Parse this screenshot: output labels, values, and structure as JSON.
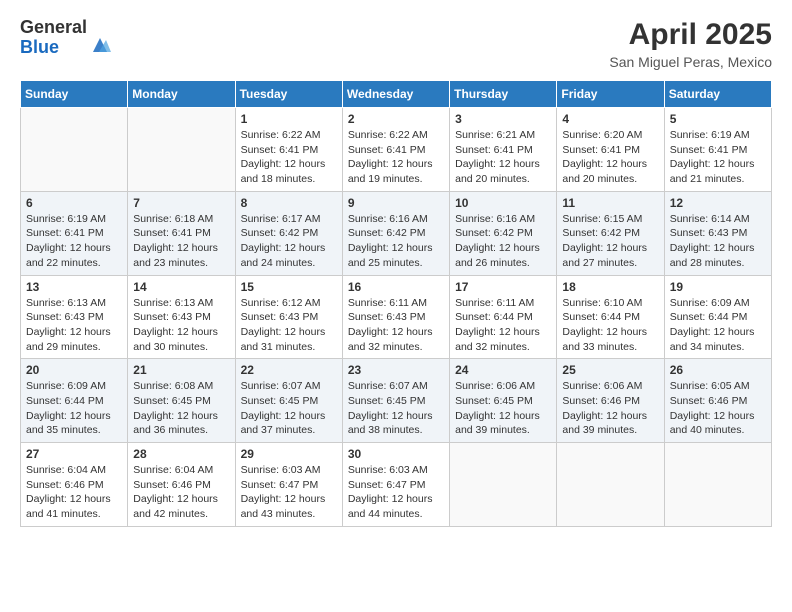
{
  "logo": {
    "general": "General",
    "blue": "Blue"
  },
  "title": "April 2025",
  "location": "San Miguel Peras, Mexico",
  "weekdays": [
    "Sunday",
    "Monday",
    "Tuesday",
    "Wednesday",
    "Thursday",
    "Friday",
    "Saturday"
  ],
  "weeks": [
    [
      {
        "day": "",
        "sunrise": "",
        "sunset": "",
        "daylight": ""
      },
      {
        "day": "",
        "sunrise": "",
        "sunset": "",
        "daylight": ""
      },
      {
        "day": "1",
        "sunrise": "Sunrise: 6:22 AM",
        "sunset": "Sunset: 6:41 PM",
        "daylight": "Daylight: 12 hours and 18 minutes."
      },
      {
        "day": "2",
        "sunrise": "Sunrise: 6:22 AM",
        "sunset": "Sunset: 6:41 PM",
        "daylight": "Daylight: 12 hours and 19 minutes."
      },
      {
        "day": "3",
        "sunrise": "Sunrise: 6:21 AM",
        "sunset": "Sunset: 6:41 PM",
        "daylight": "Daylight: 12 hours and 20 minutes."
      },
      {
        "day": "4",
        "sunrise": "Sunrise: 6:20 AM",
        "sunset": "Sunset: 6:41 PM",
        "daylight": "Daylight: 12 hours and 20 minutes."
      },
      {
        "day": "5",
        "sunrise": "Sunrise: 6:19 AM",
        "sunset": "Sunset: 6:41 PM",
        "daylight": "Daylight: 12 hours and 21 minutes."
      }
    ],
    [
      {
        "day": "6",
        "sunrise": "Sunrise: 6:19 AM",
        "sunset": "Sunset: 6:41 PM",
        "daylight": "Daylight: 12 hours and 22 minutes."
      },
      {
        "day": "7",
        "sunrise": "Sunrise: 6:18 AM",
        "sunset": "Sunset: 6:41 PM",
        "daylight": "Daylight: 12 hours and 23 minutes."
      },
      {
        "day": "8",
        "sunrise": "Sunrise: 6:17 AM",
        "sunset": "Sunset: 6:42 PM",
        "daylight": "Daylight: 12 hours and 24 minutes."
      },
      {
        "day": "9",
        "sunrise": "Sunrise: 6:16 AM",
        "sunset": "Sunset: 6:42 PM",
        "daylight": "Daylight: 12 hours and 25 minutes."
      },
      {
        "day": "10",
        "sunrise": "Sunrise: 6:16 AM",
        "sunset": "Sunset: 6:42 PM",
        "daylight": "Daylight: 12 hours and 26 minutes."
      },
      {
        "day": "11",
        "sunrise": "Sunrise: 6:15 AM",
        "sunset": "Sunset: 6:42 PM",
        "daylight": "Daylight: 12 hours and 27 minutes."
      },
      {
        "day": "12",
        "sunrise": "Sunrise: 6:14 AM",
        "sunset": "Sunset: 6:43 PM",
        "daylight": "Daylight: 12 hours and 28 minutes."
      }
    ],
    [
      {
        "day": "13",
        "sunrise": "Sunrise: 6:13 AM",
        "sunset": "Sunset: 6:43 PM",
        "daylight": "Daylight: 12 hours and 29 minutes."
      },
      {
        "day": "14",
        "sunrise": "Sunrise: 6:13 AM",
        "sunset": "Sunset: 6:43 PM",
        "daylight": "Daylight: 12 hours and 30 minutes."
      },
      {
        "day": "15",
        "sunrise": "Sunrise: 6:12 AM",
        "sunset": "Sunset: 6:43 PM",
        "daylight": "Daylight: 12 hours and 31 minutes."
      },
      {
        "day": "16",
        "sunrise": "Sunrise: 6:11 AM",
        "sunset": "Sunset: 6:43 PM",
        "daylight": "Daylight: 12 hours and 32 minutes."
      },
      {
        "day": "17",
        "sunrise": "Sunrise: 6:11 AM",
        "sunset": "Sunset: 6:44 PM",
        "daylight": "Daylight: 12 hours and 32 minutes."
      },
      {
        "day": "18",
        "sunrise": "Sunrise: 6:10 AM",
        "sunset": "Sunset: 6:44 PM",
        "daylight": "Daylight: 12 hours and 33 minutes."
      },
      {
        "day": "19",
        "sunrise": "Sunrise: 6:09 AM",
        "sunset": "Sunset: 6:44 PM",
        "daylight": "Daylight: 12 hours and 34 minutes."
      }
    ],
    [
      {
        "day": "20",
        "sunrise": "Sunrise: 6:09 AM",
        "sunset": "Sunset: 6:44 PM",
        "daylight": "Daylight: 12 hours and 35 minutes."
      },
      {
        "day": "21",
        "sunrise": "Sunrise: 6:08 AM",
        "sunset": "Sunset: 6:45 PM",
        "daylight": "Daylight: 12 hours and 36 minutes."
      },
      {
        "day": "22",
        "sunrise": "Sunrise: 6:07 AM",
        "sunset": "Sunset: 6:45 PM",
        "daylight": "Daylight: 12 hours and 37 minutes."
      },
      {
        "day": "23",
        "sunrise": "Sunrise: 6:07 AM",
        "sunset": "Sunset: 6:45 PM",
        "daylight": "Daylight: 12 hours and 38 minutes."
      },
      {
        "day": "24",
        "sunrise": "Sunrise: 6:06 AM",
        "sunset": "Sunset: 6:45 PM",
        "daylight": "Daylight: 12 hours and 39 minutes."
      },
      {
        "day": "25",
        "sunrise": "Sunrise: 6:06 AM",
        "sunset": "Sunset: 6:46 PM",
        "daylight": "Daylight: 12 hours and 39 minutes."
      },
      {
        "day": "26",
        "sunrise": "Sunrise: 6:05 AM",
        "sunset": "Sunset: 6:46 PM",
        "daylight": "Daylight: 12 hours and 40 minutes."
      }
    ],
    [
      {
        "day": "27",
        "sunrise": "Sunrise: 6:04 AM",
        "sunset": "Sunset: 6:46 PM",
        "daylight": "Daylight: 12 hours and 41 minutes."
      },
      {
        "day": "28",
        "sunrise": "Sunrise: 6:04 AM",
        "sunset": "Sunset: 6:46 PM",
        "daylight": "Daylight: 12 hours and 42 minutes."
      },
      {
        "day": "29",
        "sunrise": "Sunrise: 6:03 AM",
        "sunset": "Sunset: 6:47 PM",
        "daylight": "Daylight: 12 hours and 43 minutes."
      },
      {
        "day": "30",
        "sunrise": "Sunrise: 6:03 AM",
        "sunset": "Sunset: 6:47 PM",
        "daylight": "Daylight: 12 hours and 44 minutes."
      },
      {
        "day": "",
        "sunrise": "",
        "sunset": "",
        "daylight": ""
      },
      {
        "day": "",
        "sunrise": "",
        "sunset": "",
        "daylight": ""
      },
      {
        "day": "",
        "sunrise": "",
        "sunset": "",
        "daylight": ""
      }
    ]
  ]
}
